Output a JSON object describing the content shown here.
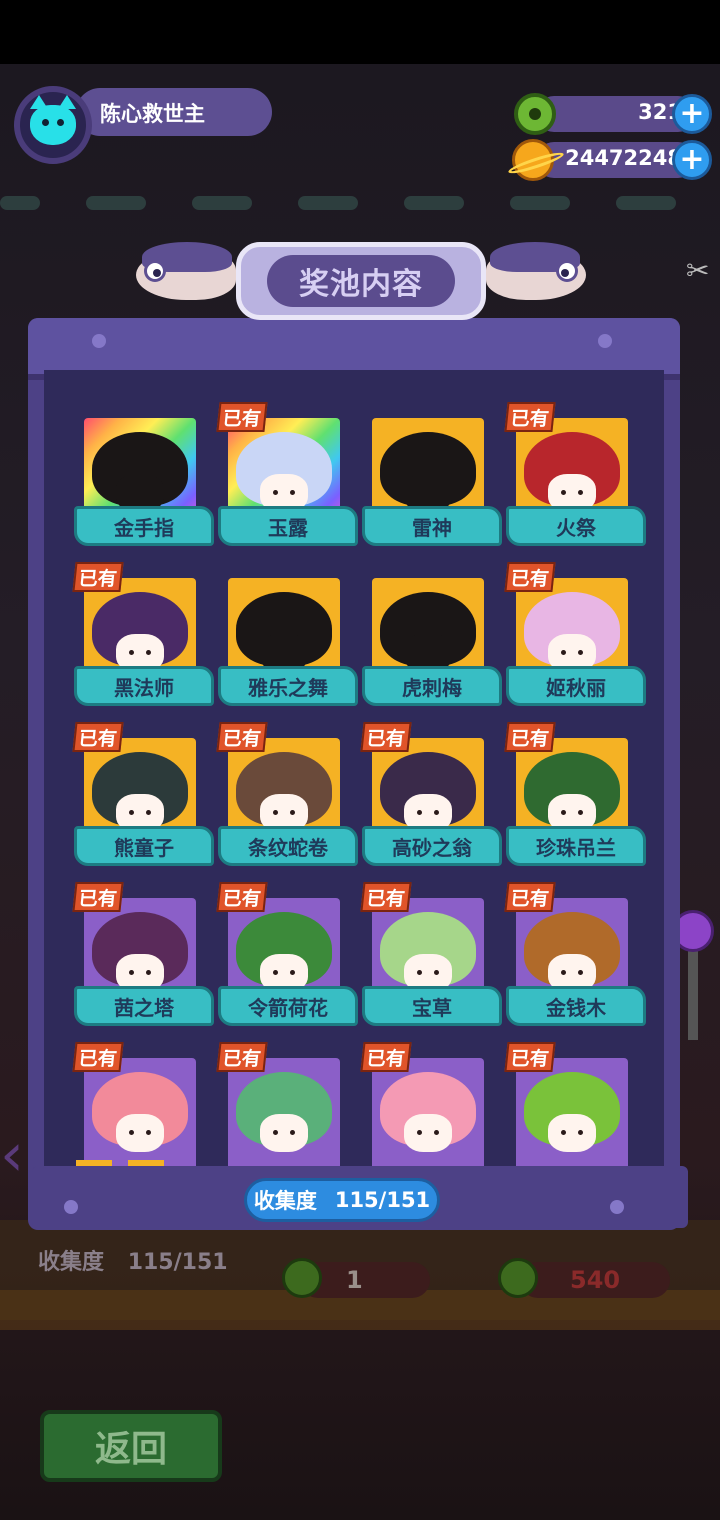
{
  "profile": {
    "name": "陈心救世主",
    "avatar_icon": "cat-face-icon"
  },
  "currency": {
    "donut": {
      "icon": "green-donut-icon",
      "value": "321"
    },
    "planet": {
      "icon": "planet-coin-icon",
      "value": "24472248"
    }
  },
  "panel": {
    "title": "奖池内容",
    "owned_label": "已有",
    "collection_label": "收集度",
    "collection_value": "115/151"
  },
  "items": [
    {
      "name": "金手指",
      "owned": false,
      "bg": "rainbow",
      "hair": "#3a2a20"
    },
    {
      "name": "玉露",
      "owned": true,
      "bg": "rainbow",
      "hair": "#c9d6f6"
    },
    {
      "name": "雷神",
      "owned": false,
      "bg": "gold",
      "hair": "#1a1616"
    },
    {
      "name": "火祭",
      "owned": true,
      "bg": "gold",
      "hair": "#b8262c"
    },
    {
      "name": "黑法师",
      "owned": true,
      "bg": "gold",
      "hair": "#4a2a66"
    },
    {
      "name": "雅乐之舞",
      "owned": false,
      "bg": "gold",
      "hair": "#1a1616"
    },
    {
      "name": "虎刺梅",
      "owned": false,
      "bg": "gold",
      "hair": "#1a1616"
    },
    {
      "name": "姬秋丽",
      "owned": true,
      "bg": "gold",
      "hair": "#e8b6e4"
    },
    {
      "name": "熊童子",
      "owned": true,
      "bg": "gold",
      "hair": "#2c3a3a"
    },
    {
      "name": "条纹蛇卷",
      "owned": true,
      "bg": "gold",
      "hair": "#6a4a3a"
    },
    {
      "name": "高砂之翁",
      "owned": true,
      "bg": "gold",
      "hair": "#3a2a4a"
    },
    {
      "name": "珍珠吊兰",
      "owned": true,
      "bg": "gold",
      "hair": "#2f6a30"
    },
    {
      "name": "茜之塔",
      "owned": true,
      "bg": "purple",
      "hair": "#5a2a5a"
    },
    {
      "name": "令箭荷花",
      "owned": true,
      "bg": "purple",
      "hair": "#3c8a3a"
    },
    {
      "name": "宝草",
      "owned": true,
      "bg": "purple",
      "hair": "#a6d68a"
    },
    {
      "name": "金钱木",
      "owned": true,
      "bg": "purple",
      "hair": "#b06a2a"
    },
    {
      "name": "",
      "owned": true,
      "bg": "purple",
      "hair": "#f28a9a"
    },
    {
      "name": "",
      "owned": true,
      "bg": "purple",
      "hair": "#5ab07a"
    },
    {
      "name": "",
      "owned": true,
      "bg": "purple",
      "hair": "#f49ab4"
    },
    {
      "name": "",
      "owned": true,
      "bg": "purple",
      "hair": "#7ac23a"
    }
  ],
  "background": {
    "collection_label": "收集度",
    "collection_value": "115/151",
    "count_value": "1",
    "price_value": "540",
    "back_label": "返回"
  }
}
